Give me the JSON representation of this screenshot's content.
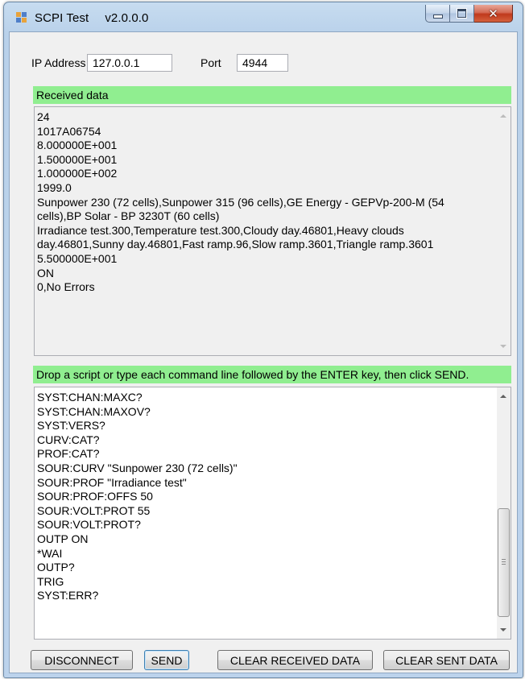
{
  "window": {
    "app_title": "SCPI Test",
    "version": "v2.0.0.0"
  },
  "connection": {
    "ip_label": "IP Address",
    "ip_value": "127.0.0.1",
    "port_label": "Port",
    "port_value": "4944"
  },
  "received": {
    "banner": "Received data",
    "lines": [
      "24",
      "1017A06754",
      "8.000000E+001",
      "1.500000E+001",
      "1.000000E+002",
      "1999.0",
      "Sunpower 230 (72 cells),Sunpower 315 (96 cells),GE Energy - GEPVp-200-M (54",
      "cells),BP Solar - BP 3230T (60 cells)",
      "Irradiance test.300,Temperature test.300,Cloudy day.46801,Heavy clouds",
      "day.46801,Sunny day.46801,Fast ramp.96,Slow ramp.3601,Triangle ramp.3601",
      "5.500000E+001",
      "ON",
      "0,No Errors"
    ]
  },
  "commands": {
    "banner": "Drop a script or type each command line followed by the ENTER key, then click SEND.",
    "lines": [
      "SYST:CHAN:MAXC?",
      "SYST:CHAN:MAXOV?",
      "SYST:VERS?",
      "CURV:CAT?",
      "PROF:CAT?",
      "SOUR:CURV \"Sunpower 230 (72 cells)\"",
      "SOUR:PROF \"Irradiance test\"",
      "SOUR:PROF:OFFS 50",
      "SOUR:VOLT:PROT 55",
      "SOUR:VOLT:PROT?",
      "OUTP ON",
      "*WAI",
      "OUTP?",
      "TRIG",
      "SYST:ERR?"
    ]
  },
  "buttons": {
    "disconnect": "DISCONNECT",
    "send": "SEND",
    "clear_received": "CLEAR RECEIVED DATA",
    "clear_sent": "CLEAR SENT DATA"
  },
  "colors": {
    "banner": "#90ee90",
    "close_button": "#c0391c"
  }
}
